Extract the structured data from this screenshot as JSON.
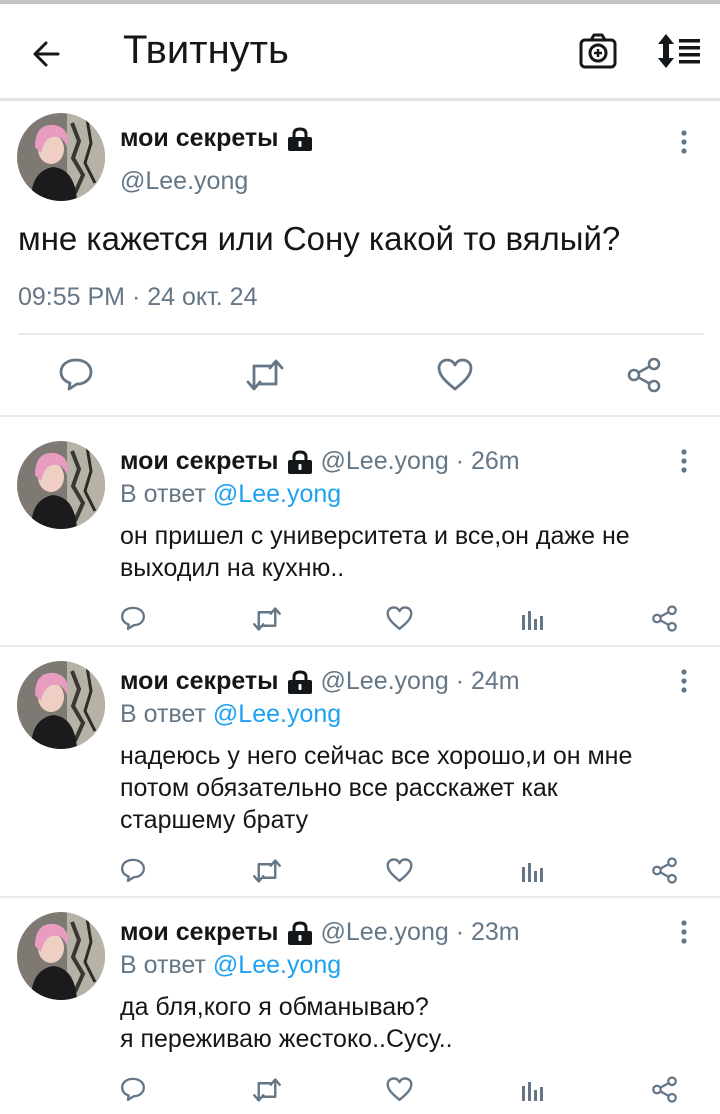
{
  "header": {
    "title": "Твитнуть",
    "icons": [
      "back-arrow-icon",
      "camera-icon",
      "sort-icon"
    ]
  },
  "main_tweet": {
    "name": "мои секреты",
    "handle": "@Lee.yong",
    "text": "мне кажется или Сону какой то вялый?",
    "timestamp": "09:55 PM · 24 окт. 24",
    "actions": [
      "reply-icon",
      "retweet-icon",
      "like-icon",
      "share-icon"
    ]
  },
  "replies": [
    {
      "name": "мои секреты",
      "handle_time": "@Lee.yong · 26m",
      "reply_prefix": "В ответ ",
      "reply_to": "@Lee.yong",
      "text": "он пришел с университета и все,он даже не\nвыходил на кухню.."
    },
    {
      "name": "мои секреты",
      "handle_time": "@Lee.yong · 24m",
      "reply_prefix": "В ответ ",
      "reply_to": "@Lee.yong",
      "text": "надеюсь у него сейчас все хорошо,и он мне\nпотом обязательно все расскажет как\nстаршему брату"
    },
    {
      "name": "мои секреты",
      "handle_time": "@Lee.yong · 23m",
      "reply_prefix": "В ответ ",
      "reply_to": "@Lee.yong",
      "text": "да бля,кого я обманываю?\nя переживаю жестоко..Сусу.."
    }
  ],
  "colors": {
    "text": "#14171a",
    "secondary": "#657786",
    "mention": "#1da1f2",
    "icon": "#657786"
  }
}
